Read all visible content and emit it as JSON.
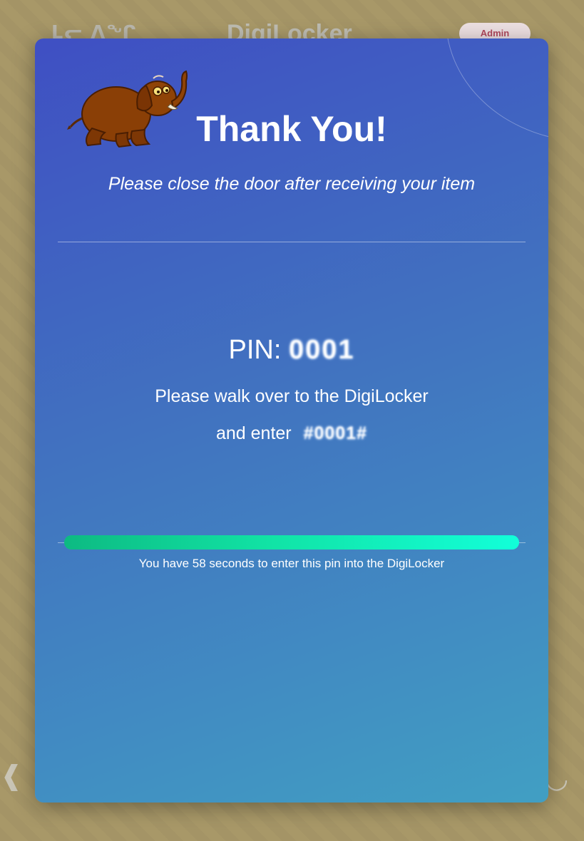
{
  "background": {
    "logo_text": "ᒪᓕ ᐱᖏ",
    "title": "DigiLocker",
    "admin_button": "Admin"
  },
  "modal": {
    "title": "Thank You!",
    "subtitle": "Please close the door after receiving your item",
    "pin_label": "PIN:",
    "pin_value": "0001",
    "instruction_line1": "Please walk over to the DigiLocker",
    "instruction_line2_prefix": "and enter",
    "entry_code": "#0001#",
    "countdown_text": "You have 58 seconds to enter this pin into the DigiLocker",
    "progress_fraction": 1.0
  },
  "colors": {
    "modal_gradient_start": "#3f4fc3",
    "modal_gradient_end": "#419fc3",
    "progress_start": "#0dba82",
    "progress_end": "#12ffd9",
    "admin_text": "#b0485c"
  },
  "icons": [
    "elephant-mascot-icon"
  ]
}
